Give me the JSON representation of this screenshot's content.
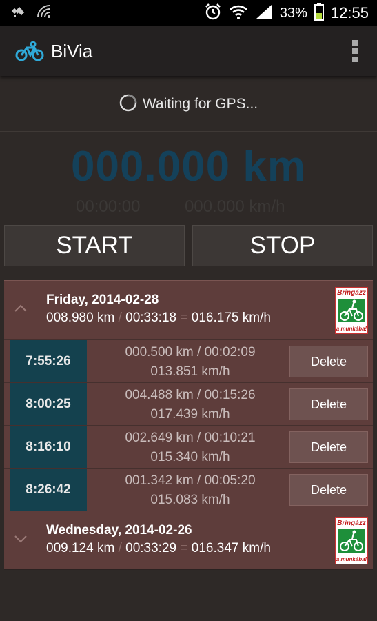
{
  "status_bar": {
    "battery_percent": "33%",
    "time": "12:55",
    "icons": [
      "gps-icon",
      "signal-wave-icon",
      "alarm-icon",
      "wifi-icon",
      "cell-signal-icon",
      "battery-icon"
    ]
  },
  "app": {
    "title": "BiVia",
    "icon": "bicycle-icon"
  },
  "gps_status": "Waiting for GPS...",
  "tracker": {
    "distance": "000.000 km",
    "elapsed": "00:00:00",
    "speed": "000.000 km/h"
  },
  "buttons": {
    "start": "START",
    "stop": "STOP"
  },
  "days": [
    {
      "title": "Friday, 2014-02-28",
      "distance": "008.980 km",
      "sep1": "/",
      "duration": "00:33:18",
      "sep2": "=",
      "speed": "016.175 km/h",
      "expanded": true,
      "logo_top": "Bringázz",
      "logo_bottom": "a munkába!",
      "rides": [
        {
          "time": "7:55:26",
          "line1": "000.500 km / 00:02:09",
          "line2": "013.851 km/h",
          "delete_label": "Delete"
        },
        {
          "time": "8:00:25",
          "line1": "004.488 km / 00:15:26",
          "line2": "017.439 km/h",
          "delete_label": "Delete"
        },
        {
          "time": "8:16:10",
          "line1": "002.649 km / 00:10:21",
          "line2": "015.340 km/h",
          "delete_label": "Delete"
        },
        {
          "time": "8:26:42",
          "line1": "001.342 km / 00:05:20",
          "line2": "015.083 km/h",
          "delete_label": "Delete"
        }
      ]
    },
    {
      "title": "Wednesday, 2014-02-26",
      "distance": "009.124 km",
      "sep1": "/",
      "duration": "00:33:29",
      "sep2": "=",
      "speed": "016.347 km/h",
      "expanded": false,
      "logo_top": "Bringázz",
      "logo_bottom": "a munkába!",
      "rides": []
    }
  ],
  "colors": {
    "background": "#2e2927",
    "list_row": "#5e3d3b",
    "time_cell": "#14414e",
    "distance_text": "#14415a"
  }
}
